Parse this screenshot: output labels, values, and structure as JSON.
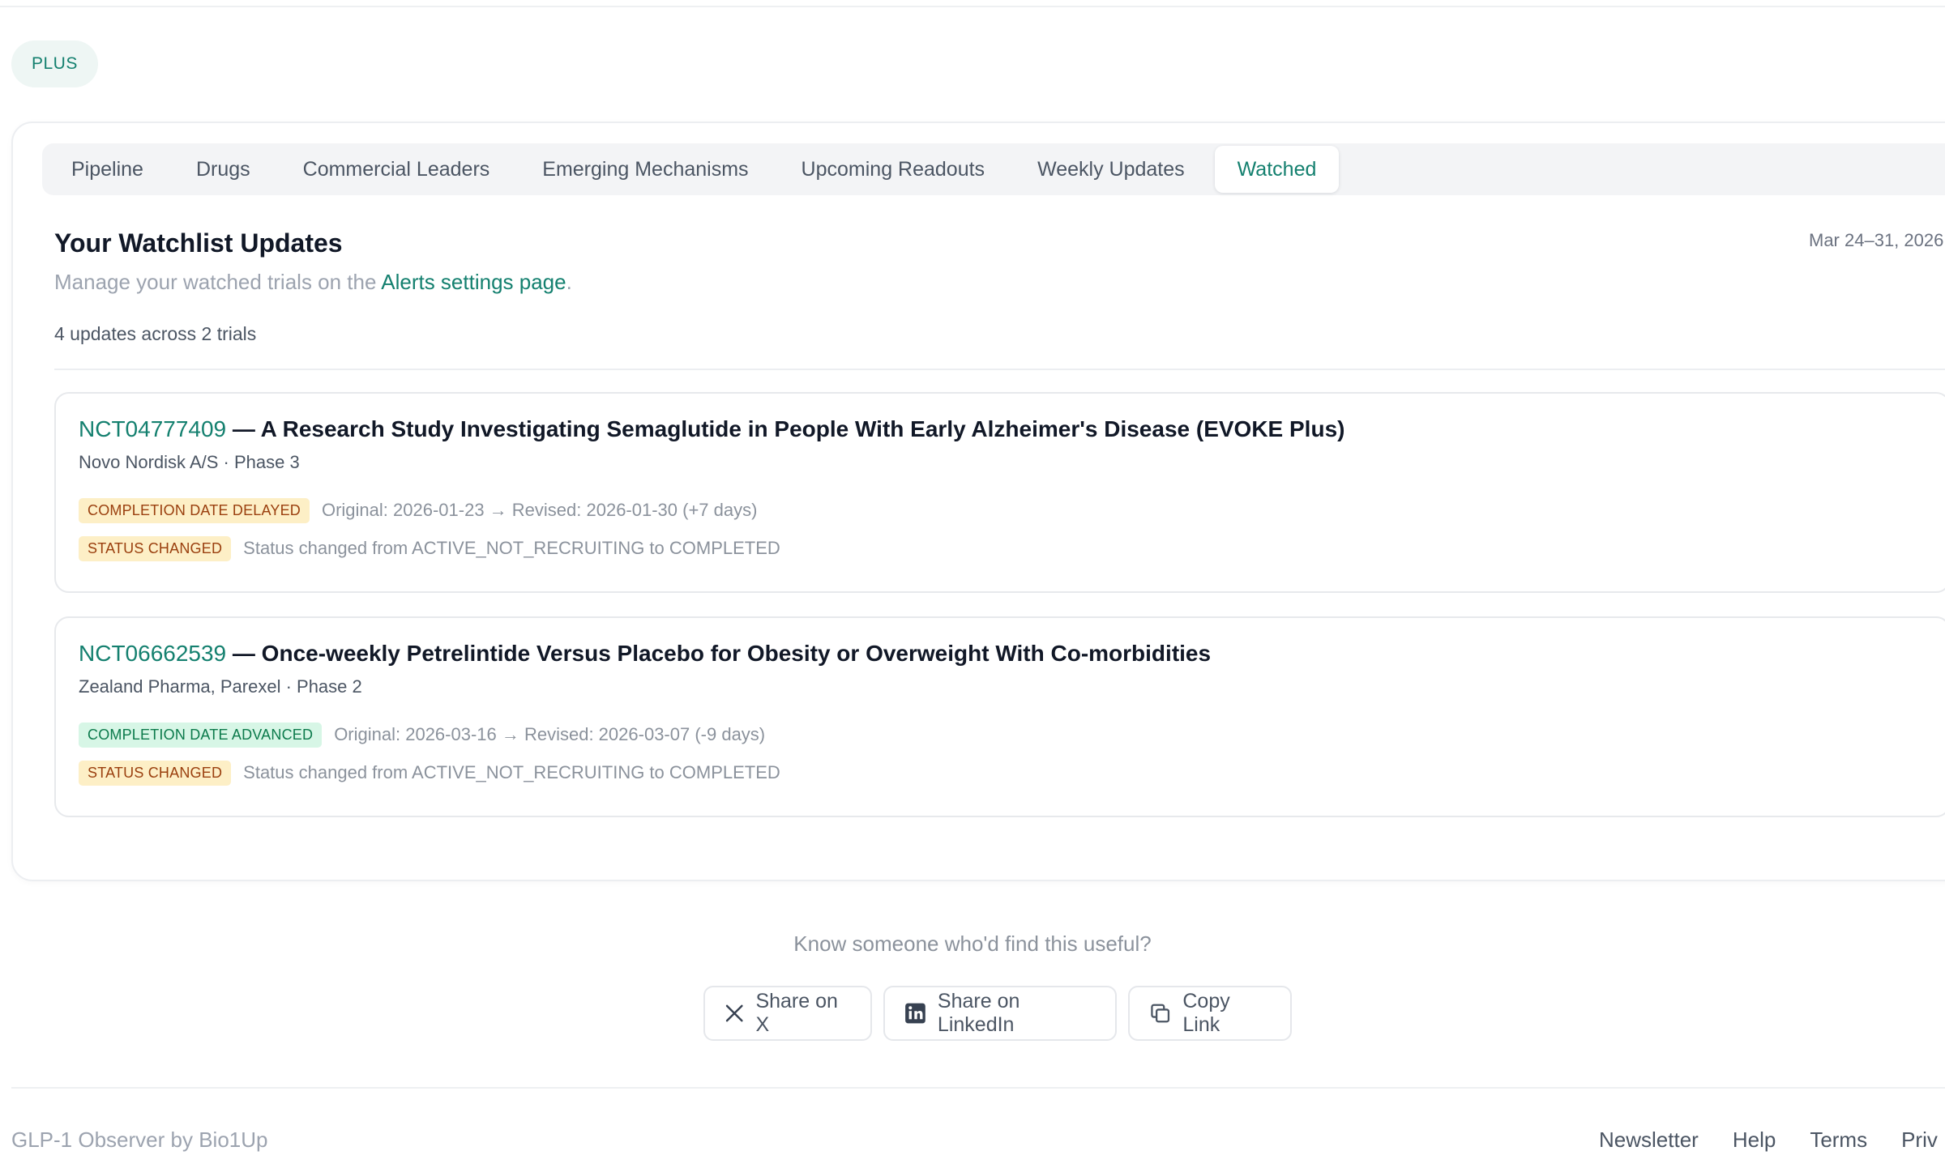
{
  "plan_badge": "PLUS",
  "tabs": [
    {
      "label": "Pipeline"
    },
    {
      "label": "Drugs"
    },
    {
      "label": "Commercial Leaders"
    },
    {
      "label": "Emerging Mechanisms"
    },
    {
      "label": "Upcoming Readouts"
    },
    {
      "label": "Weekly Updates"
    },
    {
      "label": "Watched",
      "active": true
    }
  ],
  "watchlist": {
    "title": "Your Watchlist Updates",
    "date_range": "Mar 24–31, 2026",
    "manage_prefix": "Manage your watched trials on the ",
    "manage_link": "Alerts settings page",
    "manage_suffix": ".",
    "summary": "4 updates across 2 trials"
  },
  "trials": [
    {
      "id": "NCT04777409",
      "title": " — A Research Study Investigating Semaglutide in People With Early Alzheimer's Disease (EVOKE Plus)",
      "sponsor_phase": "Novo Nordisk A/S · Phase 3",
      "changes": [
        {
          "tag": "COMPLETION DATE DELAYED",
          "tag_color": "#fdefc6",
          "text": "Original: 2026-01-23 → Revised: 2026-01-30 (+7 days)"
        },
        {
          "tag": "STATUS CHANGED",
          "tag_color": "#fdefc6",
          "text": "Status changed from ACTIVE_NOT_RECRUITING to COMPLETED"
        }
      ]
    },
    {
      "id": "NCT06662539",
      "title": " — Once-weekly Petrelintide Versus Placebo for Obesity or Overweight With Co-morbidities",
      "sponsor_phase": "Zealand Pharma, Parexel · Phase 2",
      "changes": [
        {
          "tag": "COMPLETION DATE ADVANCED",
          "tag_color": "#d7f6e6",
          "text": "Original: 2026-03-16 → Revised: 2026-03-07 (-9 days)"
        },
        {
          "tag": "STATUS CHANGED",
          "tag_color": "#fdefc6",
          "text": "Status changed from ACTIVE_NOT_RECRUITING to COMPLETED"
        }
      ]
    }
  ],
  "share": {
    "prompt": "Know someone who'd find this useful?",
    "x_label": "Share on X",
    "linkedin_label": "Share on LinkedIn",
    "copy_label": "Copy Link",
    "icons": [
      "x-logo-icon",
      "linkedin-icon",
      "copy-icon"
    ]
  },
  "footer": {
    "brand": "GLP-1 Observer by Bio1Up",
    "links": [
      "Newsletter",
      "Help",
      "Terms",
      "Priv"
    ]
  },
  "colors": {
    "accent": "#14806f",
    "amber_tag": "#fdefc6",
    "green_tag": "#d7f6e6"
  }
}
